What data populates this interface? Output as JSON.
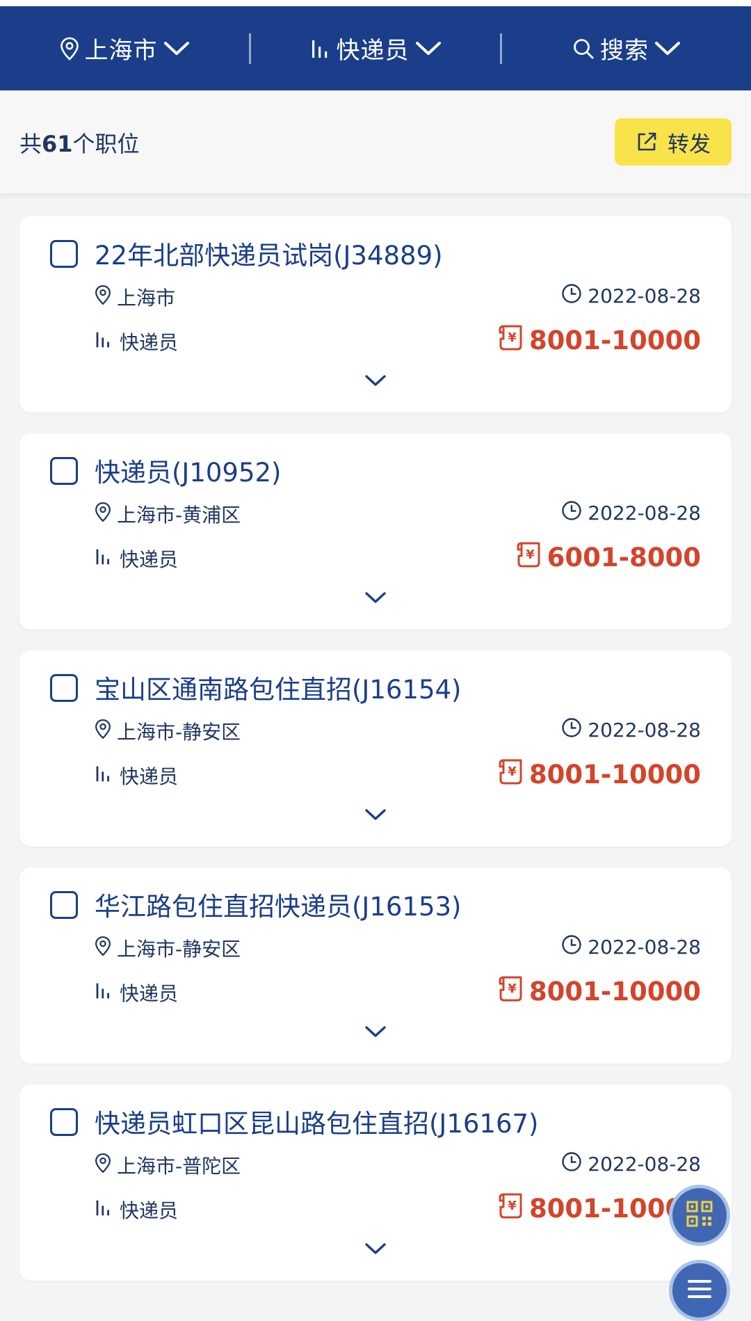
{
  "filters": {
    "city": "上海市",
    "position": "快递员",
    "search": "搜索"
  },
  "summary": {
    "prefix": "共",
    "count": "61",
    "suffix": "个职位",
    "forward_label": "转发"
  },
  "jobs": [
    {
      "title": "22年北部快递员试岗(J34889)",
      "location": "上海市",
      "date": "2022-08-28",
      "category": "快递员",
      "salary": "8001-10000"
    },
    {
      "title": "快递员(J10952)",
      "location": "上海市-黄浦区",
      "date": "2022-08-28",
      "category": "快递员",
      "salary": "6001-8000"
    },
    {
      "title": "宝山区通南路包住直招(J16154)",
      "location": "上海市-静安区",
      "date": "2022-08-28",
      "category": "快递员",
      "salary": "8001-10000"
    },
    {
      "title": "华江路包住直招快递员(J16153)",
      "location": "上海市-静安区",
      "date": "2022-08-28",
      "category": "快递员",
      "salary": "8001-10000"
    },
    {
      "title": "快递员虹口区昆山路包住直招(J16167)",
      "location": "上海市-普陀区",
      "date": "2022-08-28",
      "category": "快递员",
      "salary": "8001-10000"
    }
  ],
  "colors": {
    "brand": "#1a3e8a",
    "accent": "#f9e34a",
    "salary": "#d4442a"
  },
  "icons": {
    "city": "location-pin-icon",
    "position": "bar-chart-icon",
    "search": "search-icon",
    "forward": "share-external-icon",
    "date": "clock-icon",
    "salary": "salary-receipt-icon",
    "expand": "chevron-down-icon",
    "qr": "qr-code-icon",
    "menu": "menu-icon"
  }
}
